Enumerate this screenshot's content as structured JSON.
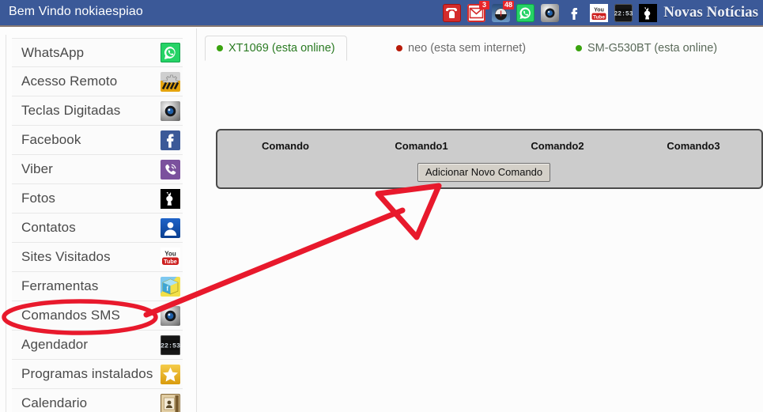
{
  "header": {
    "welcome_text": "Bem Vindo nokiaespiao",
    "news_label": "Novas Notícias",
    "background_color": "#3b5998",
    "icons": [
      {
        "name": "phone-icon",
        "badge": ""
      },
      {
        "name": "mail-icon",
        "badge": "3"
      },
      {
        "name": "speedometer-icon",
        "badge": "48"
      },
      {
        "name": "whatsapp-icon",
        "badge": ""
      },
      {
        "name": "camera-icon",
        "badge": ""
      },
      {
        "name": "facebook-icon",
        "badge": ""
      },
      {
        "name": "youtube-icon",
        "badge": ""
      },
      {
        "name": "clock-icon",
        "badge": ""
      },
      {
        "name": "playboy-icon",
        "badge": ""
      }
    ]
  },
  "sidebar": {
    "items": [
      {
        "label": "WhatsApp",
        "icon": "whatsapp-icon"
      },
      {
        "label": "Acesso Remoto",
        "icon": "gear-icon"
      },
      {
        "label": "Teclas Digitadas",
        "icon": "camera-icon"
      },
      {
        "label": "Facebook",
        "icon": "facebook-icon"
      },
      {
        "label": "Viber",
        "icon": "viber-icon"
      },
      {
        "label": "Fotos",
        "icon": "playboy-icon"
      },
      {
        "label": "Contatos",
        "icon": "contact-icon"
      },
      {
        "label": "Sites Visitados",
        "icon": "youtube-icon"
      },
      {
        "label": "Ferramentas",
        "icon": "toolbox-icon"
      },
      {
        "label": "Comandos SMS",
        "icon": "camera-icon"
      },
      {
        "label": "Agendador",
        "icon": "clock-icon"
      },
      {
        "label": "Programas instalados",
        "icon": "star-icon"
      },
      {
        "label": "Calendario",
        "icon": "calendar-icon"
      }
    ]
  },
  "tabs": [
    {
      "label": "XT1069 (esta online)",
      "status": "online",
      "active": true
    },
    {
      "label": "neo (esta sem internet)",
      "status": "offline",
      "active": false
    },
    {
      "label": "SM-G530BT (esta online)",
      "status": "online",
      "active": false
    }
  ],
  "command_panel": {
    "columns": [
      "Comando",
      "Comando1",
      "Comando2",
      "Comando3"
    ],
    "add_button_label": "Adicionar Novo Comando"
  },
  "annotations": {
    "color": "#e8192c",
    "ellipse_target": "Comandos SMS",
    "arrow_points_to": "Adicionar Novo Comando"
  }
}
